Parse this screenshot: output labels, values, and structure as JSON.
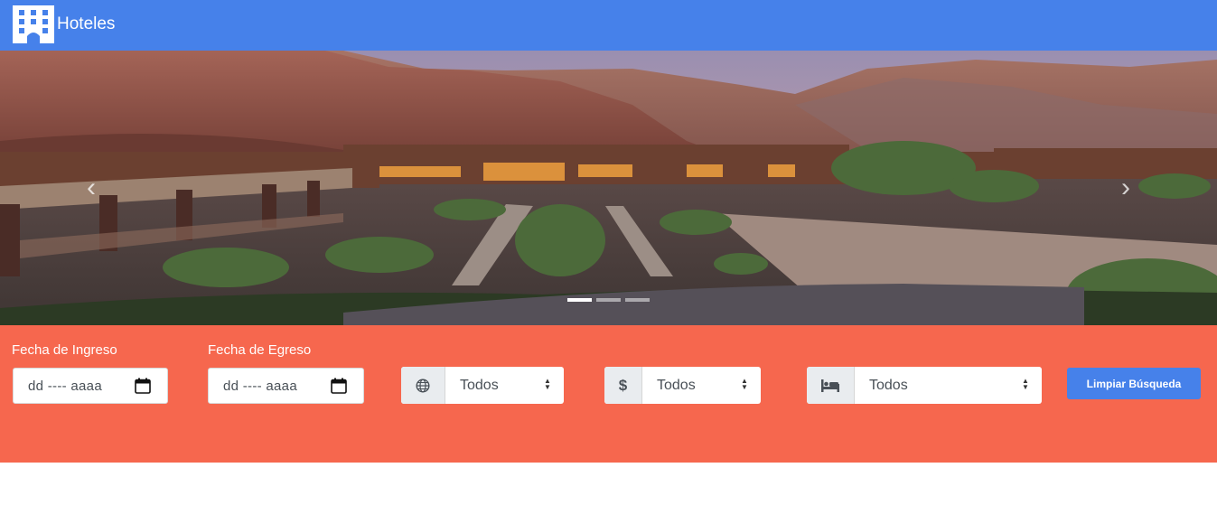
{
  "header": {
    "brand": "Hoteles",
    "logo_icon": "hotel-building-icon",
    "background": "#4681ea"
  },
  "carousel": {
    "prev_icon": "chevron-left-icon",
    "next_icon": "chevron-right-icon",
    "slide_count": 3,
    "active_slide": 1
  },
  "search": {
    "background": "#f6674e",
    "checkin": {
      "label": "Fecha de Ingreso",
      "placeholder": "dd ---- aaaa",
      "icon": "calendar-icon"
    },
    "checkout": {
      "label": "Fecha de Egreso",
      "placeholder": "dd ---- aaaa",
      "icon": "calendar-icon"
    },
    "country": {
      "icon": "globe-icon",
      "value": "Todos"
    },
    "price": {
      "icon": "dollar-icon",
      "value": "Todos"
    },
    "rooms": {
      "icon": "bed-icon",
      "value": "Todos"
    },
    "clear_button": "Limpiar Búsqueda"
  }
}
